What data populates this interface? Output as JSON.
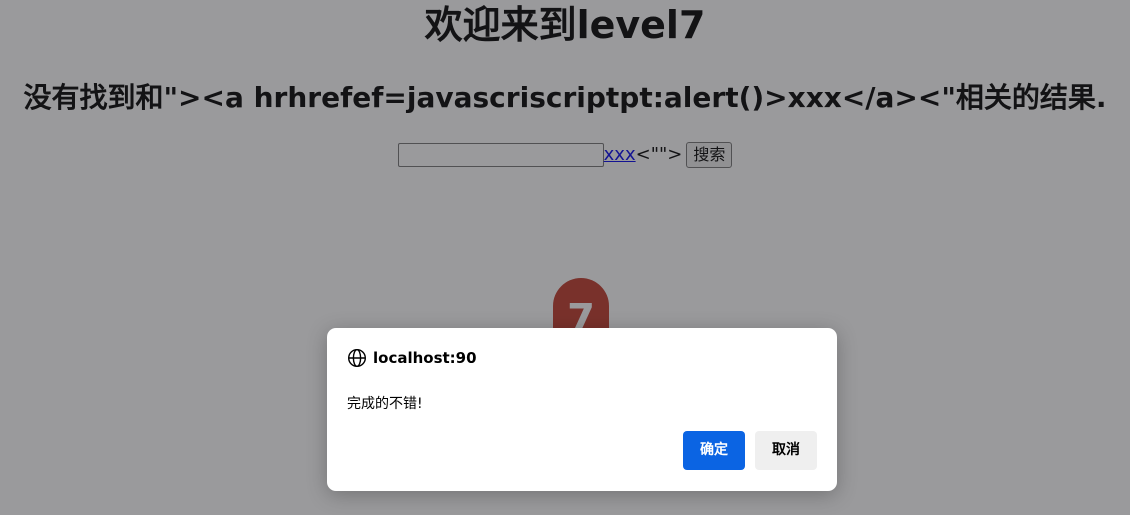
{
  "page": {
    "title": "欢迎来到level7",
    "result_text": "没有找到和\"><a hrhrefef=javascriscriptpt:alert()>xxx</a><\"相关的结果.",
    "search": {
      "input_value": "",
      "injected_link_text": "xxx",
      "injected_trailing_text": "<\"\">",
      "button_label": "搜索"
    },
    "logo_text": "7"
  },
  "dialog": {
    "origin": "localhost:90",
    "message": "完成的不错!",
    "ok_label": "确定",
    "cancel_label": "取消"
  },
  "colors": {
    "overlay": "#28282c",
    "ok_button": "#0b64e3",
    "cancel_button": "#efefef",
    "logo": "#c0392b"
  },
  "icons": {
    "origin_icon": "globe-icon"
  }
}
